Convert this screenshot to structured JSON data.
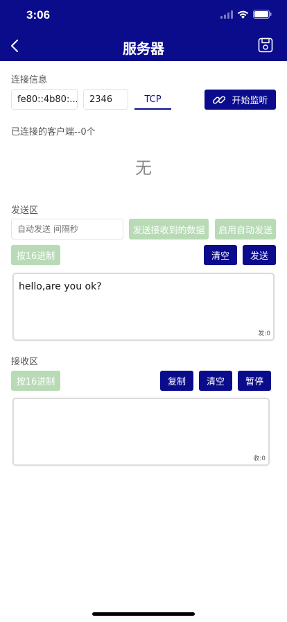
{
  "status": {
    "time": "3:06"
  },
  "nav": {
    "title": "服务器"
  },
  "connection": {
    "label": "连接信息",
    "ip_value": "fe80::4b80:...",
    "port_value": "2346",
    "protocol_tab": "TCP",
    "listen_button": "开始监听"
  },
  "clients": {
    "label": "已连接的客户端--0个",
    "empty_text": "无"
  },
  "send": {
    "label": "发送区",
    "interval_placeholder": "自动发送 间隔秒",
    "send_received_button": "发送接收到的数据",
    "auto_send_button": "启用自动发送",
    "hex_button": "按16进制",
    "clear_button": "清空",
    "send_button": "发送",
    "text": "hello,are you ok?",
    "counter": "发:0"
  },
  "receive": {
    "label": "接收区",
    "hex_button": "按16进制",
    "copy_button": "复制",
    "clear_button": "清空",
    "pause_button": "暂停",
    "text": "",
    "counter": "收:0"
  },
  "colors": {
    "primary": "#0b0c8c",
    "disabled_green": "#b8dbb6"
  }
}
